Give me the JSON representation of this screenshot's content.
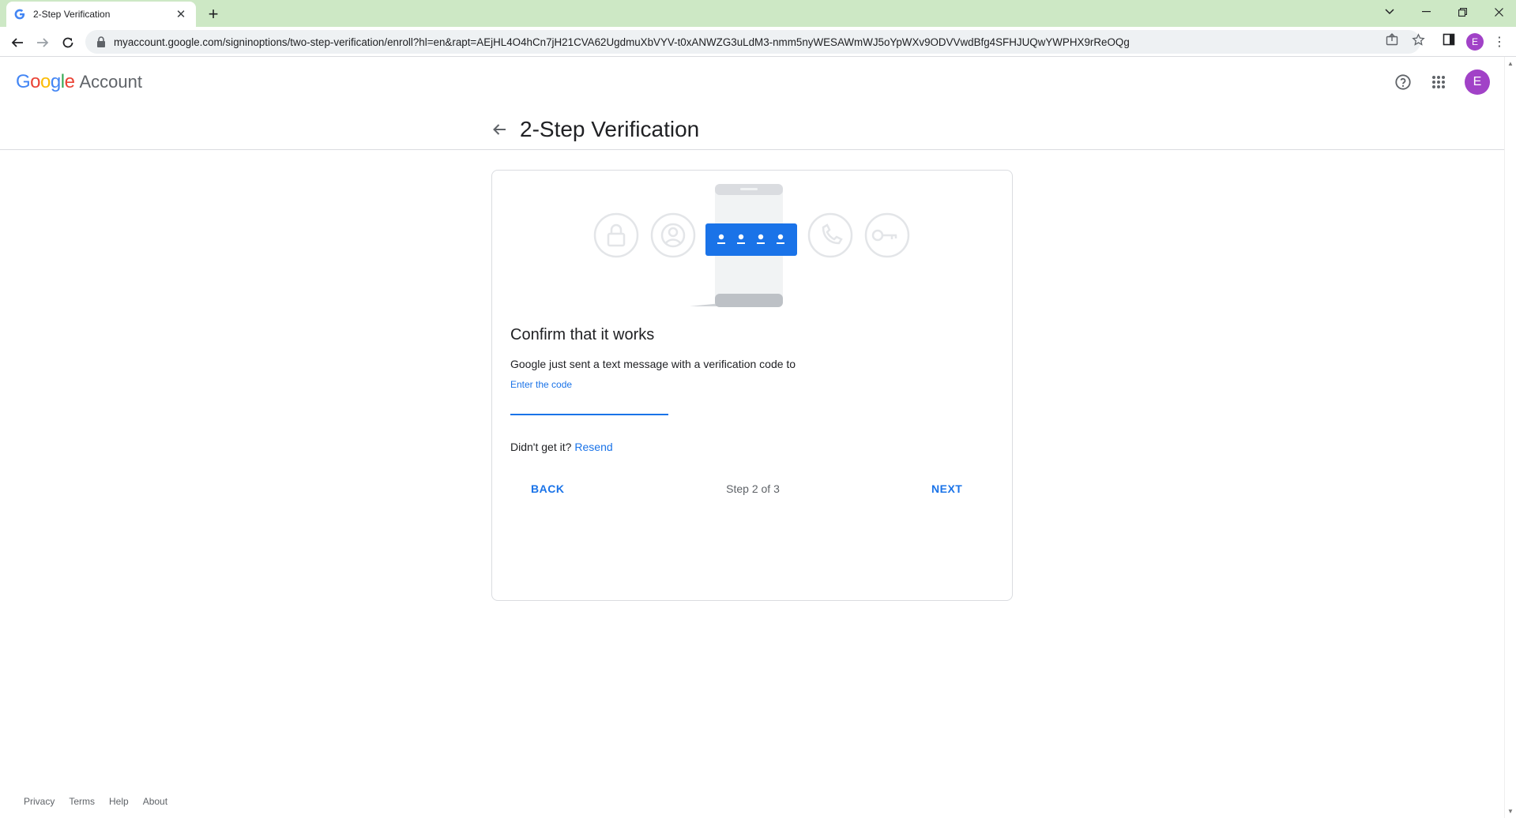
{
  "browser": {
    "tab_title": "2-Step Verification",
    "url": "myaccount.google.com/signinoptions/two-step-verification/enroll?hl=en&rapt=AEjHL4O4hCn7jH21CVA62UgdmuXbVYV-t0xANWZG3uLdM3-nmm5nyWESAWmWJ5oYpWXv9ODVVwdBfg4SFHJUQwYWPHX9rReOQg",
    "profile_initial": "E"
  },
  "header": {
    "logo_letters": [
      "G",
      "o",
      "o",
      "g",
      "l",
      "e"
    ],
    "logo_colors": [
      "#4285F4",
      "#EA4335",
      "#FBBC05",
      "#4285F4",
      "#34A853",
      "#EA4335"
    ],
    "logo_suffix": "Account",
    "avatar_initial": "E",
    "avatar_color": "#a142c7"
  },
  "page": {
    "title": "2-Step Verification"
  },
  "card": {
    "heading": "Confirm that it works",
    "description": "Google just sent a text message with a verification code to",
    "code_label": "Enter the code",
    "code_value": "",
    "resend_prompt": "Didn't get it?",
    "resend_link": "Resend",
    "back_label": "BACK",
    "step_text": "Step 2 of 3",
    "next_label": "NEXT"
  },
  "footer": {
    "links": [
      "Privacy",
      "Terms",
      "Help",
      "About"
    ]
  },
  "colors": {
    "accent": "#1a73e8",
    "tabbar": "#cde8c5",
    "illustration_blue": "#1a73e8"
  }
}
